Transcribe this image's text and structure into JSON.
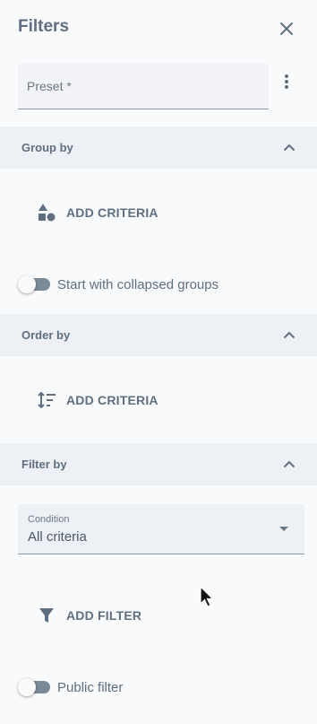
{
  "header": {
    "title": "Filters"
  },
  "preset": {
    "placeholder": "Preset *"
  },
  "group_by": {
    "title": "Group by",
    "add_label": "ADD CRITERIA",
    "toggle_label": "Start with collapsed groups",
    "toggle_on": false
  },
  "order_by": {
    "title": "Order by",
    "add_label": "ADD CRITERIA"
  },
  "filter_by": {
    "title": "Filter by",
    "condition_label": "Condition",
    "condition_value": "All criteria",
    "add_label": "ADD FILTER"
  },
  "public_filter": {
    "label": "Public filter",
    "toggle_on": false
  },
  "icons": {
    "close": "close-icon",
    "more": "more-vert-icon",
    "chevron": "chevron-up-icon",
    "group": "shapes-icon",
    "order": "sort-icon",
    "filter": "funnel-icon"
  },
  "colors": {
    "background": "#f8fafc",
    "section_header": "#edf0f4",
    "text": "#5f6f80",
    "toggle_track": "#7a8a99"
  }
}
